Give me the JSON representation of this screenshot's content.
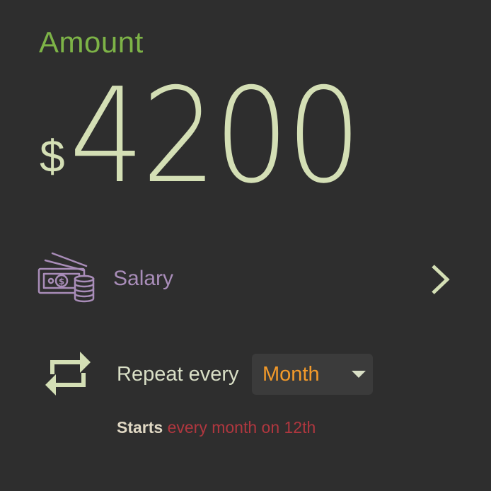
{
  "amount": {
    "label": "Amount",
    "currency_symbol": "$",
    "value": "4200"
  },
  "category": {
    "icon": "money-coins-icon",
    "label": "Salary",
    "chevron_icon": "chevron-right-icon"
  },
  "repeat": {
    "icon": "repeat-icon",
    "label": "Repeat every",
    "selected_period": "Month",
    "caret_icon": "dropdown-caret-icon"
  },
  "schedule": {
    "prefix": "Starts",
    "detail": "every month on 12th"
  },
  "colors": {
    "background": "#2e2e2e",
    "amount_label": "#7db347",
    "amount_value": "#d4dfb5",
    "category": "#a98db9",
    "period": "#f39a2a",
    "schedule_detail": "#b0373f"
  }
}
